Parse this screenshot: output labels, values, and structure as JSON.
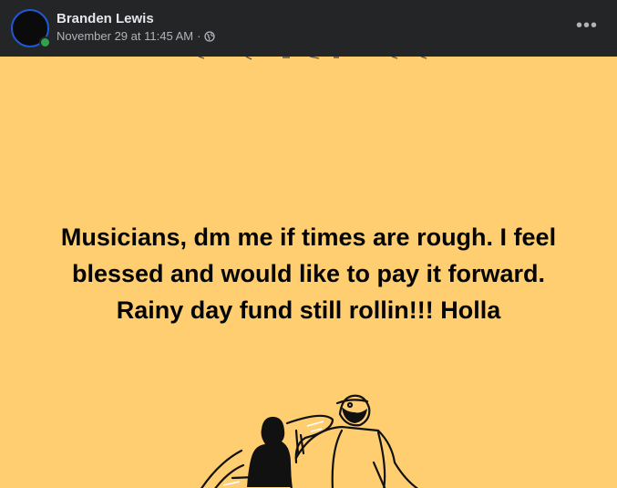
{
  "post": {
    "author": "Branden Lewis",
    "timestamp": "November 29 at 11:45 AM",
    "separator": "·",
    "privacy_icon": "globe-icon",
    "more_icon": "more-options-icon",
    "more_label": "•••",
    "status_text": "Musicians, dm me if times are rough. I feel\nblessed and would like to pay it forward.\nRainy day fund still rollin!!! Holla",
    "background_color": "#fece70",
    "illustration": "two-friends-illustration"
  }
}
